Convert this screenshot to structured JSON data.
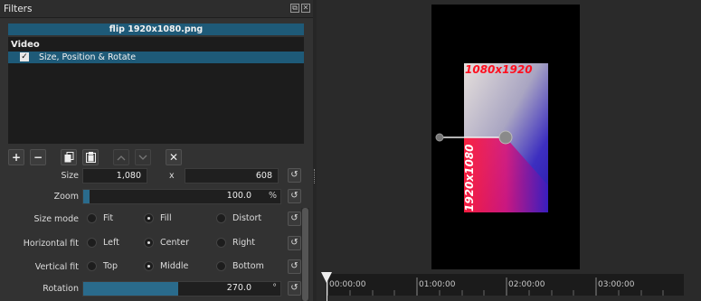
{
  "panel": {
    "title": "Filters",
    "float_icon": "⧉",
    "close_icon": "✕"
  },
  "clip": {
    "name": "flip 1920x1080.png"
  },
  "filters": {
    "section": "Video",
    "items": [
      {
        "checked": "✓",
        "name": "Size, Position & Rotate"
      }
    ]
  },
  "toolbar": {
    "add": "+",
    "remove": "−",
    "copy": "⎘",
    "paste": "📋",
    "up": "⌃",
    "down": "⌄",
    "deselect": "✕"
  },
  "controls": {
    "size": {
      "label": "Size",
      "width": "1,080",
      "x": "x",
      "height": "608"
    },
    "zoom": {
      "label": "Zoom",
      "value": "100.0",
      "unit": "%",
      "fraction": 0.03
    },
    "size_mode": {
      "label": "Size mode",
      "options": [
        "Fit",
        "Fill",
        "Distort"
      ],
      "selected": "Fill"
    },
    "horizontal_fit": {
      "label": "Horizontal fit",
      "options": [
        "Left",
        "Center",
        "Right"
      ],
      "selected": "Center"
    },
    "vertical_fit": {
      "label": "Vertical fit",
      "options": [
        "Top",
        "Middle",
        "Bottom"
      ],
      "selected": "Middle"
    },
    "rotation": {
      "label": "Rotation",
      "value": "270.0",
      "unit": "°",
      "fraction": 0.5
    }
  },
  "undo_glyph": "↺",
  "preview": {
    "top_label": "1080x1920",
    "rot_label": "1920x1080"
  },
  "timeline": {
    "ticks": [
      "00:00:00",
      "01:00:00",
      "02:00:00",
      "03:00:00"
    ]
  }
}
